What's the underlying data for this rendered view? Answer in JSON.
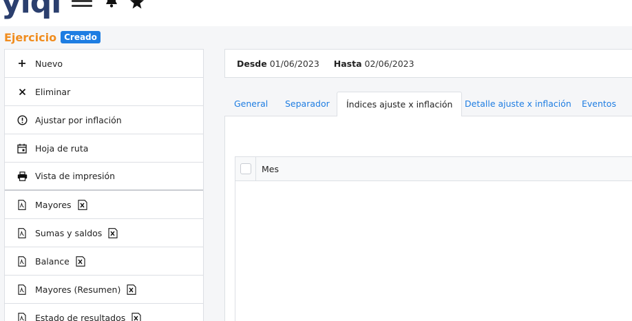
{
  "header": {
    "logo_text": "yiqi",
    "menu_icon": "hamburger-icon",
    "notifications_icon": "bell-icon",
    "favorites_icon": "star-icon"
  },
  "page": {
    "title": "Ejercicio",
    "status": "Creado"
  },
  "sidebar": {
    "items": [
      {
        "label": "Nuevo",
        "icon": "plus-icon"
      },
      {
        "label": "Eliminar",
        "icon": "close-icon"
      },
      {
        "label": "Ajustar por inflación",
        "icon": "alert-circle-icon"
      },
      {
        "label": "Hoja de ruta",
        "icon": "calendar-icon"
      },
      {
        "label": "Vista de impresión",
        "icon": "printer-icon"
      },
      {
        "label": "Mayores",
        "icon": "pdf-icon",
        "extra_icon": "excel-icon"
      },
      {
        "label": "Sumas y saldos",
        "icon": "pdf-icon",
        "extra_icon": "excel-icon"
      },
      {
        "label": "Balance",
        "icon": "pdf-icon",
        "extra_icon": "excel-icon"
      },
      {
        "label": "Mayores (Resumen)",
        "icon": "pdf-icon",
        "extra_icon": "excel-icon"
      },
      {
        "label": "Estado de resultados",
        "icon": "pdf-icon",
        "extra_icon": "excel-icon"
      }
    ]
  },
  "dates": {
    "from_label": "Desde",
    "from_value": "01/06/2023",
    "to_label": "Hasta",
    "to_value": "02/06/2023"
  },
  "tabs": [
    {
      "label": "General",
      "active": false
    },
    {
      "label": "Separador",
      "active": false
    },
    {
      "label": "Índices ajuste x inflación",
      "active": true
    },
    {
      "label": "Detalle ajuste x inflación",
      "active": false
    },
    {
      "label": "Eventos",
      "active": false
    }
  ],
  "grid": {
    "columns": [
      "Mes"
    ],
    "rows": []
  },
  "colors": {
    "accent": "#1e7de2",
    "title": "#f08c1e",
    "logo": "#2b3f6e"
  }
}
